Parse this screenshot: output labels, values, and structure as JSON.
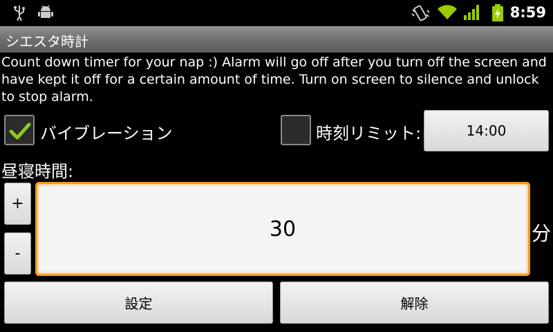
{
  "status_bar": {
    "time": "8:59",
    "icons": [
      "usb-icon",
      "android-debug-icon",
      "vibrate-icon",
      "wifi-icon",
      "signal-icon",
      "battery-charging-icon"
    ],
    "accent_color": "#99cc00"
  },
  "app": {
    "title": "シエスタ時計"
  },
  "description": "Count down timer for your nap :) Alarm will go off after you turn off the screen and have kept it off for a certain amount of time. Turn on screen to silence and unlock to stop alarm.",
  "vibration": {
    "label": "バイブレーション",
    "checked": true
  },
  "time_limit": {
    "label": "時刻リミット:",
    "checked": false,
    "value": "14:00"
  },
  "nap": {
    "label": "昼寝時間:",
    "plus_label": "+",
    "minus_label": "-",
    "value": "30",
    "unit": "分"
  },
  "actions": {
    "set_label": "設定",
    "cancel_label": "解除"
  },
  "colors": {
    "focus": "#f59a1b",
    "check": "#88cc22"
  }
}
